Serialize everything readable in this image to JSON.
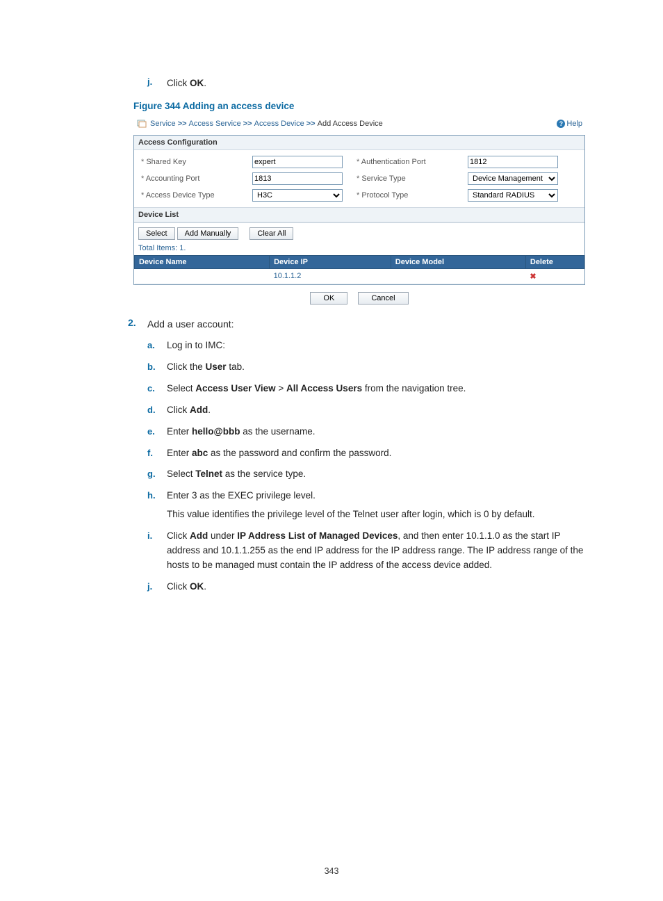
{
  "step_pre": {
    "marker": "j.",
    "prefix": "Click ",
    "bold": "OK",
    "suffix": "."
  },
  "figure_caption": "Figure 344 Adding an access device",
  "screenshot": {
    "breadcrumb": {
      "help": "Help",
      "items": [
        "Service",
        "Access Service",
        "Access Device"
      ],
      "current": "Add Access Device"
    },
    "access_config": {
      "title": "Access Configuration",
      "fields": {
        "shared_key": {
          "label": "Shared Key",
          "value": "expert"
        },
        "auth_port": {
          "label": "Authentication Port",
          "value": "1812"
        },
        "acct_port": {
          "label": "Accounting Port",
          "value": "1813"
        },
        "service_type": {
          "label": "Service Type",
          "value": "Device Management S"
        },
        "access_dev_type": {
          "label": "Access Device Type",
          "value": "H3C"
        },
        "protocol_type": {
          "label": "Protocol Type",
          "value": "Standard RADIUS"
        }
      }
    },
    "device_list": {
      "title": "Device List",
      "buttons": {
        "select": "Select",
        "add_manually": "Add Manually",
        "clear_all": "Clear All"
      },
      "total": "Total Items: 1.",
      "columns": {
        "name": "Device Name",
        "ip": "Device IP",
        "model": "Device Model",
        "del": "Delete"
      },
      "rows": [
        {
          "name": "",
          "ip": "10.1.1.2",
          "model": ""
        }
      ]
    },
    "actions": {
      "ok": "OK",
      "cancel": "Cancel"
    }
  },
  "step2": {
    "marker": "2.",
    "intro": "Add a user account:",
    "sub": {
      "a": {
        "m": "a.",
        "text": "Log in to IMC:"
      },
      "b": {
        "m": "b.",
        "pre": "Click the ",
        "b1": "User",
        "post": " tab."
      },
      "c": {
        "m": "c.",
        "pre": "Select ",
        "b1": "Access User View",
        "mid": " > ",
        "b2": "All Access Users",
        "post": " from the navigation tree."
      },
      "d": {
        "m": "d.",
        "pre": "Click ",
        "b1": "Add",
        "post": "."
      },
      "e": {
        "m": "e.",
        "pre": "Enter ",
        "b1": "hello@bbb",
        "post": " as the username."
      },
      "f": {
        "m": "f.",
        "pre": "Enter ",
        "b1": "abc",
        "post": " as the password and confirm the password."
      },
      "g": {
        "m": "g.",
        "pre": "Select ",
        "b1": "Telnet",
        "post": " as the service type."
      },
      "h": {
        "m": "h.",
        "line1": "Enter 3 as the EXEC privilege level.",
        "line2": "This value identifies the privilege level of the Telnet user after login, which is 0 by default."
      },
      "i": {
        "m": "i.",
        "pre": "Click ",
        "b1": "Add",
        "mid": " under ",
        "b2": "IP Address List of Managed Devices",
        "post": ", and then enter 10.1.1.0 as the start IP address and 10.1.1.255 as the end IP address for the IP address range. The IP address range of the hosts to be managed must contain the IP address of the access device added."
      },
      "j": {
        "m": "j.",
        "pre": "Click ",
        "b1": "OK",
        "post": "."
      }
    }
  },
  "page_number": "343"
}
